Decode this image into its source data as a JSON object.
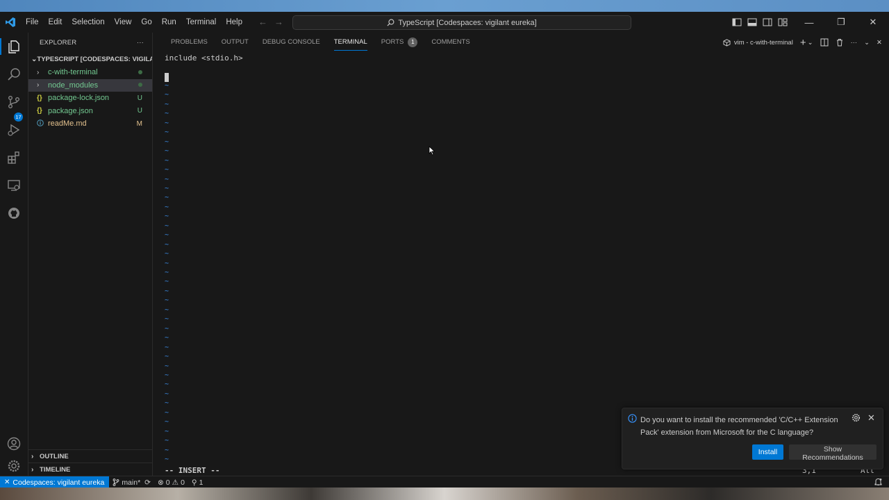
{
  "app": {
    "menu": [
      "File",
      "Edit",
      "Selection",
      "View",
      "Go",
      "Run",
      "Terminal",
      "Help"
    ],
    "command_center": "TypeScript [Codespaces: vigilant eureka]"
  },
  "activity": {
    "source_control_badge": "17"
  },
  "explorer": {
    "header": "EXPLORER",
    "more": "···",
    "workspace": "TYPESCRIPT [CODESPACES: VIGILA...",
    "items": [
      {
        "name": "c-with-terminal",
        "icon": "chevron-right",
        "decoration": "dot",
        "color": "#73c991"
      },
      {
        "name": "node_modules",
        "icon": "chevron-right",
        "decoration": "dot",
        "color": "#73c991"
      },
      {
        "name": "package-lock.json",
        "icon": "{}",
        "decoration": "U",
        "color": "#73c991"
      },
      {
        "name": "package.json",
        "icon": "{}",
        "decoration": "U",
        "color": "#73c991"
      },
      {
        "name": "readMe.md",
        "icon": "info",
        "decoration": "M",
        "color": "#e2c08d"
      }
    ],
    "outline": "OUTLINE",
    "timeline": "TIMELINE"
  },
  "panel": {
    "tabs": [
      {
        "label": "PROBLEMS"
      },
      {
        "label": "OUTPUT"
      },
      {
        "label": "DEBUG CONSOLE"
      },
      {
        "label": "TERMINAL",
        "active": true
      },
      {
        "label": "PORTS",
        "count": "1"
      },
      {
        "label": "COMMENTS"
      }
    ],
    "terminal_name": "vim - c-with-terminal"
  },
  "terminal": {
    "line1": "include <stdio.h>",
    "tilde": "~",
    "mode": "-- INSERT --",
    "position": "3,1",
    "scroll": "All"
  },
  "notification": {
    "message": "Do you want to install the recommended 'C/C++ Extension Pack' extension from Microsoft for the C language?",
    "install": "Install",
    "show_recommendations": "Show Recommendations"
  },
  "status": {
    "remote": "Codespaces: vigilant eureka",
    "branch": "main*",
    "errors": "0",
    "warnings": "0",
    "ports": "1"
  },
  "colors": {
    "accent": "#0078d4",
    "tilde": "#3b8eea",
    "untracked": "#73c991",
    "modified": "#e2c08d"
  }
}
